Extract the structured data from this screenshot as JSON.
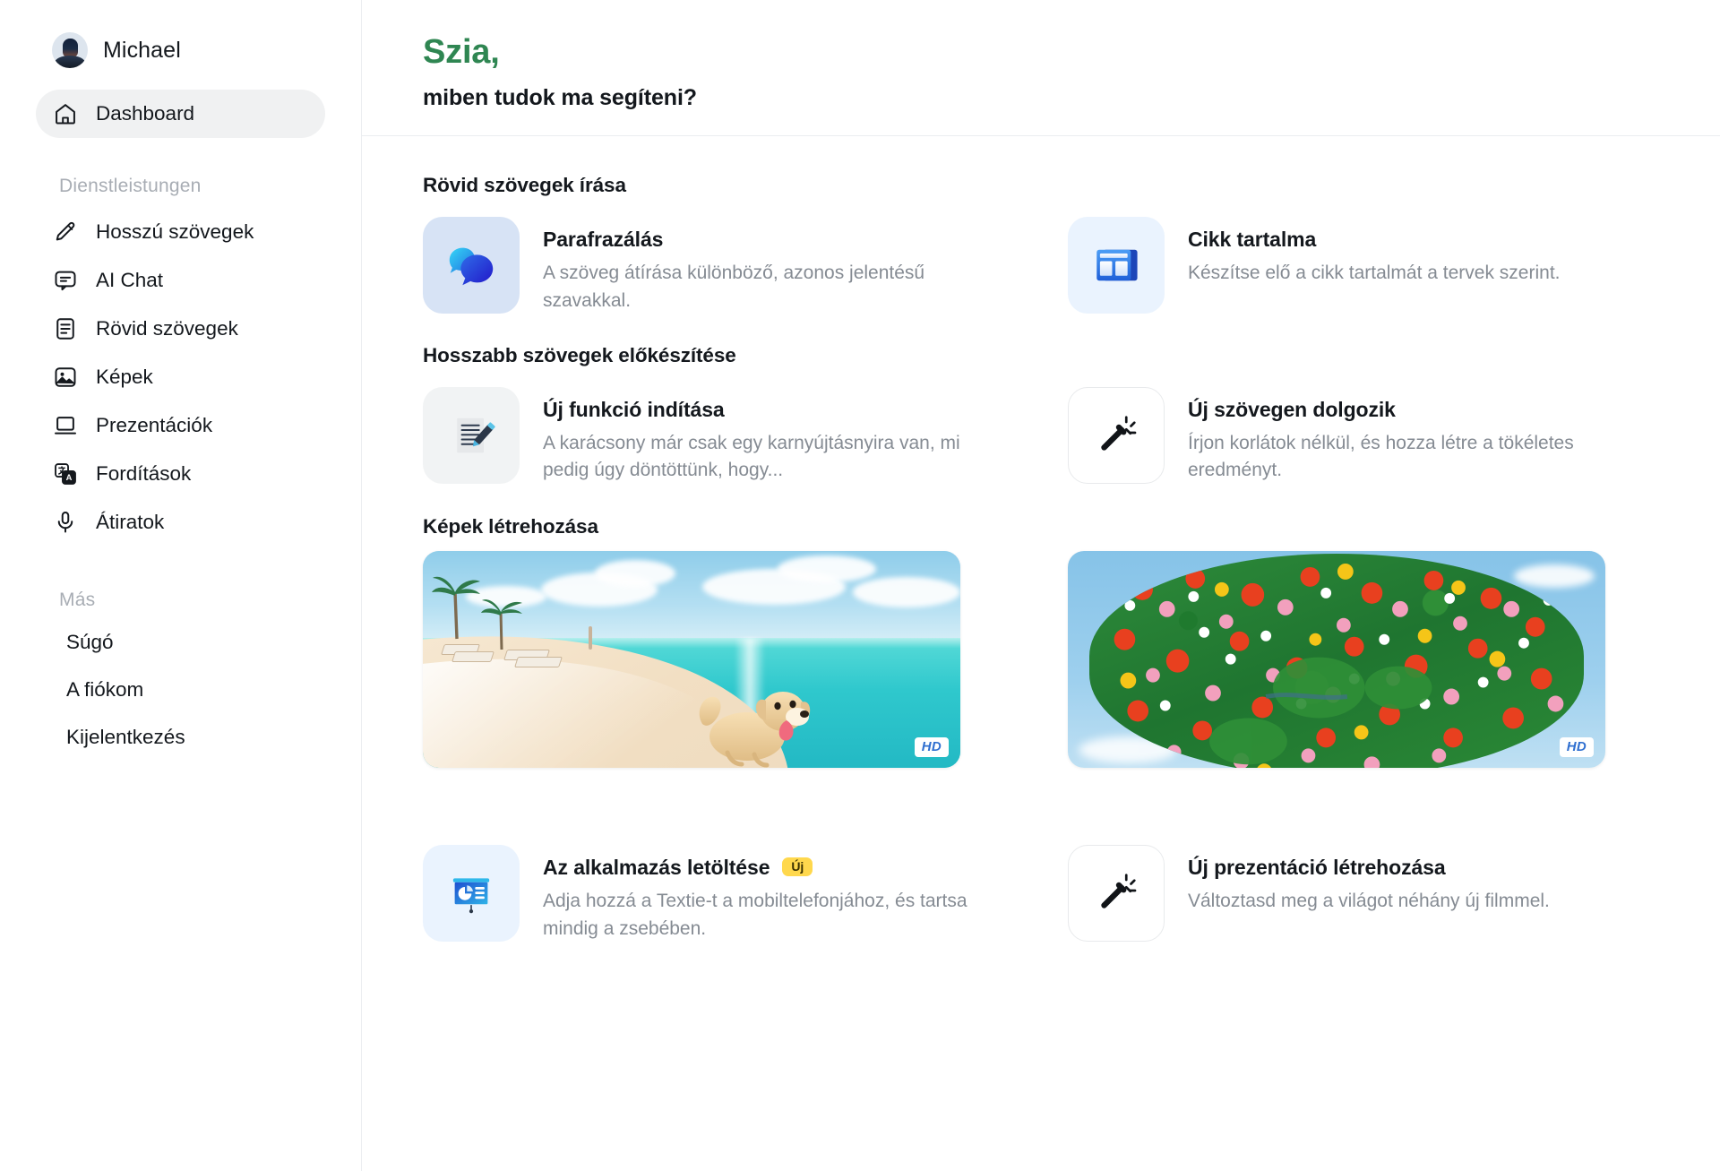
{
  "sidebar": {
    "user": {
      "name": "Michael",
      "avatar_icon": "user-avatar-icon"
    },
    "dashboard": {
      "label": "Dashboard",
      "icon": "home-icon"
    },
    "services_label": "Dienstleistungen",
    "services": [
      {
        "label": "Hosszú szövegek",
        "icon": "pencil-icon"
      },
      {
        "label": "AI Chat",
        "icon": "chat-bubble-icon"
      },
      {
        "label": "Rövid szövegek",
        "icon": "document-lines-icon"
      },
      {
        "label": "Képek",
        "icon": "image-icon"
      },
      {
        "label": "Prezentációk",
        "icon": "laptop-icon"
      },
      {
        "label": "Fordítások",
        "icon": "translate-icon"
      },
      {
        "label": "Átiratok",
        "icon": "microphone-icon"
      }
    ],
    "other_label": "Más",
    "other": [
      {
        "label": "Súgó"
      },
      {
        "label": "A fiókom"
      },
      {
        "label": "Kijelentkezés"
      }
    ]
  },
  "header": {
    "greeting": "Szia,",
    "subtitle": "miben tudok ma segíteni?",
    "greeting_color": "#2f8652"
  },
  "sections": [
    {
      "title": "Rövid szövegek írása",
      "cards": [
        {
          "title": "Parafrazálás",
          "desc": "A szöveg átírása különböző, azonos jelentésű szavakkal.",
          "icon": "speech-bubbles-icon",
          "badge": ""
        },
        {
          "title": "Cikk tartalma",
          "desc": "Készítse elő a cikk tartalmát a tervek szerint.",
          "icon": "article-layout-icon",
          "badge": ""
        }
      ]
    },
    {
      "title": "Hosszabb szövegek előkészítése",
      "cards": [
        {
          "title": "Új funkció indítása",
          "desc": "A karácsony már csak egy karnyújtásnyira van, mi pedig úgy döntöttünk, hogy...",
          "icon": "document-pencil-icon",
          "badge": ""
        },
        {
          "title": "Új szövegen dolgozik",
          "desc": "Írjon korlátok nélkül, és hozza létre a tökéletes eredményt.",
          "icon": "magic-wand-icon",
          "badge": ""
        }
      ]
    },
    {
      "title": "Képek létrehozása",
      "images": [
        {
          "alt": "Kutya a tengerparton",
          "quality_badge": "HD"
        },
        {
          "alt": "Virágzó bokor",
          "quality_badge": "HD"
        }
      ]
    }
  ],
  "bottom_cards": [
    {
      "title": "Az alkalmazás letöltése",
      "badge": "Új",
      "desc": "Adja hozzá a Textie-t a mobiltelefonjához, és tartsa mindig a zsebében.",
      "icon": "presentation-chart-icon"
    },
    {
      "title": "Új prezentáció létrehozása",
      "badge": "",
      "desc": "Változtasd meg a világot néhány új filmmel.",
      "icon": "magic-wand-icon"
    }
  ],
  "colors": {
    "accent_green": "#2f8652",
    "badge_yellow": "#ffd84d",
    "hd_blue": "#2f6fd0"
  }
}
